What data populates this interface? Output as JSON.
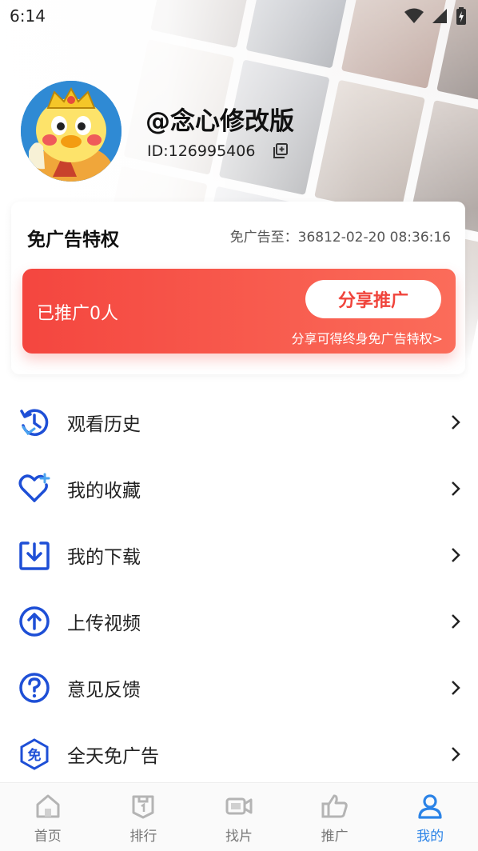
{
  "status_bar": {
    "time": "6:14"
  },
  "profile": {
    "username": "@念心修改版",
    "user_id": "ID:126995406"
  },
  "privilege": {
    "title": "免广告特权",
    "expire_text": "免广告至：36812-02-20 08:36:16",
    "promoted_text": "已推广0人",
    "share_button": "分享推广",
    "share_tip": "分享可得终身免广告特权>"
  },
  "menu": {
    "items": [
      {
        "label": "观看历史",
        "icon": "history-icon"
      },
      {
        "label": "我的收藏",
        "icon": "heart-plus-icon"
      },
      {
        "label": "我的下载",
        "icon": "download-icon"
      },
      {
        "label": "上传视频",
        "icon": "upload-icon"
      },
      {
        "label": "意见反馈",
        "icon": "help-icon"
      },
      {
        "label": "全天免广告",
        "icon": "ad-free-icon"
      }
    ]
  },
  "bottom_nav": {
    "items": [
      {
        "label": "首页",
        "icon": "home-icon"
      },
      {
        "label": "排行",
        "icon": "ranking-icon"
      },
      {
        "label": "找片",
        "icon": "video-camera-icon"
      },
      {
        "label": "推广",
        "icon": "thumbs-up-icon"
      },
      {
        "label": "我的",
        "icon": "user-icon",
        "active": true
      }
    ]
  },
  "ad_free_glyph": "免",
  "colors": {
    "accent_blue": "#2b83e7",
    "icon_blue": "#1e4fd6",
    "promo_red": "#f4463f"
  }
}
